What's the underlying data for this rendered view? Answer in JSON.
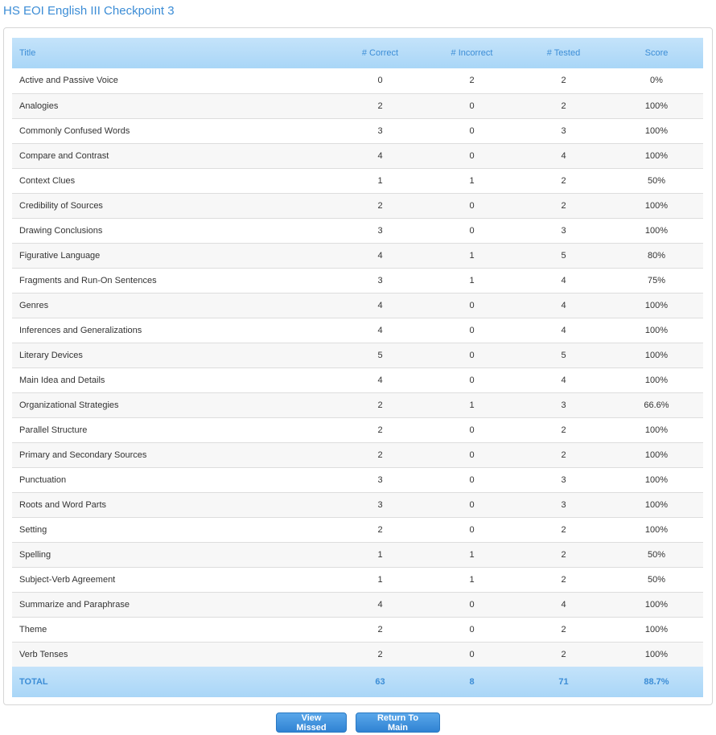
{
  "page": {
    "title": "HS EOI English III Checkpoint 3"
  },
  "table": {
    "headers": [
      "Title",
      "# Correct",
      "# Incorrect",
      "# Tested",
      "Score"
    ],
    "rows": [
      [
        "Active and Passive Voice",
        "0",
        "2",
        "2",
        "0%"
      ],
      [
        "Analogies",
        "2",
        "0",
        "2",
        "100%"
      ],
      [
        "Commonly Confused Words",
        "3",
        "0",
        "3",
        "100%"
      ],
      [
        "Compare and Contrast",
        "4",
        "0",
        "4",
        "100%"
      ],
      [
        "Context Clues",
        "1",
        "1",
        "2",
        "50%"
      ],
      [
        "Credibility of Sources",
        "2",
        "0",
        "2",
        "100%"
      ],
      [
        "Drawing Conclusions",
        "3",
        "0",
        "3",
        "100%"
      ],
      [
        "Figurative Language",
        "4",
        "1",
        "5",
        "80%"
      ],
      [
        "Fragments and Run-On Sentences",
        "3",
        "1",
        "4",
        "75%"
      ],
      [
        "Genres",
        "4",
        "0",
        "4",
        "100%"
      ],
      [
        "Inferences and Generalizations",
        "4",
        "0",
        "4",
        "100%"
      ],
      [
        "Literary Devices",
        "5",
        "0",
        "5",
        "100%"
      ],
      [
        "Main Idea and Details",
        "4",
        "0",
        "4",
        "100%"
      ],
      [
        "Organizational Strategies",
        "2",
        "1",
        "3",
        "66.6%"
      ],
      [
        "Parallel Structure",
        "2",
        "0",
        "2",
        "100%"
      ],
      [
        "Primary and Secondary Sources",
        "2",
        "0",
        "2",
        "100%"
      ],
      [
        "Punctuation",
        "3",
        "0",
        "3",
        "100%"
      ],
      [
        "Roots and Word Parts",
        "3",
        "0",
        "3",
        "100%"
      ],
      [
        "Setting",
        "2",
        "0",
        "2",
        "100%"
      ],
      [
        "Spelling",
        "1",
        "1",
        "2",
        "50%"
      ],
      [
        "Subject-Verb Agreement",
        "1",
        "1",
        "2",
        "50%"
      ],
      [
        "Summarize and Paraphrase",
        "4",
        "0",
        "4",
        "100%"
      ],
      [
        "Theme",
        "2",
        "0",
        "2",
        "100%"
      ],
      [
        "Verb Tenses",
        "2",
        "0",
        "2",
        "100%"
      ]
    ],
    "total": [
      "TOTAL",
      "63",
      "8",
      "71",
      "88.7%"
    ]
  },
  "actions": {
    "view_missed_label": "View Missed",
    "return_main_label": "Return To Main"
  },
  "colors": {
    "accent": "#3c8dd6",
    "header_bg": "#b6dcf8",
    "row_alt": "#f7f7f7",
    "button": "#3a8ddb"
  }
}
